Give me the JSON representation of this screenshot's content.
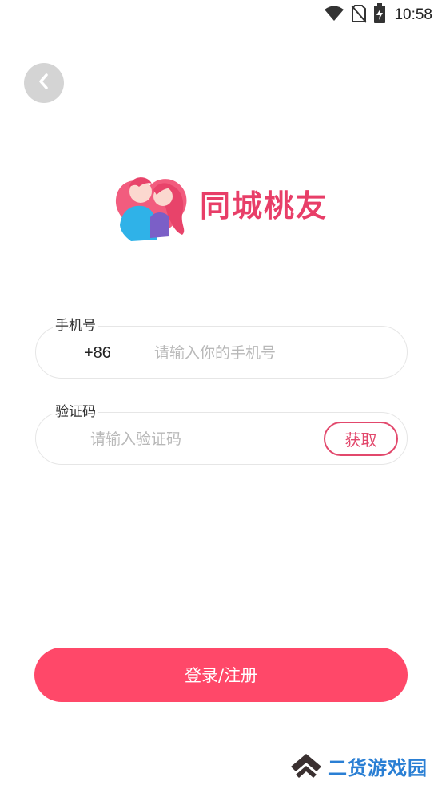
{
  "status_bar": {
    "time": "10:58",
    "icons": [
      "wifi-icon",
      "no-sim-icon",
      "battery-charging-icon"
    ]
  },
  "header": {
    "back_icon": "chevron-left-icon"
  },
  "logo": {
    "title": "同城桃友",
    "brand_color": "#e83e68"
  },
  "phone_field": {
    "label": "手机号",
    "prefix": "+86",
    "placeholder": "请输入你的手机号",
    "value": ""
  },
  "code_field": {
    "label": "验证码",
    "placeholder": "请输入验证码",
    "value": "",
    "get_code_label": "获取"
  },
  "login_button": {
    "label": "登录/注册",
    "color": "#ff4869"
  },
  "watermark": {
    "text": "二货游戏园",
    "color": "#2a7fd4"
  }
}
